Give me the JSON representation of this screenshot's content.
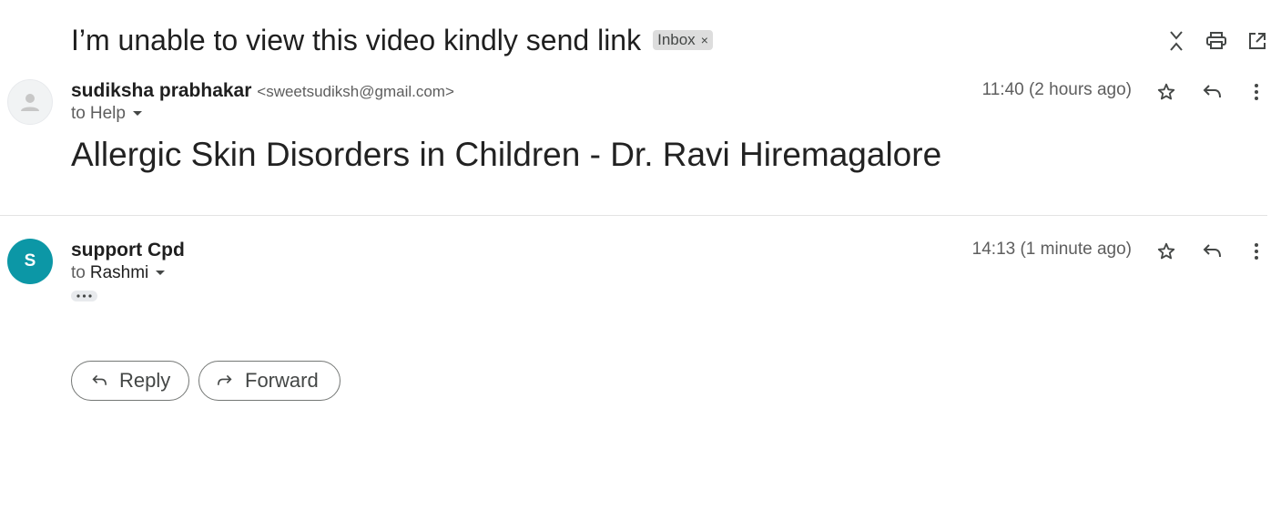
{
  "thread": {
    "subject": "I’m unable to view this video kindly send link",
    "label": "Inbox",
    "label_remove": "×"
  },
  "toolbar": {
    "icons": [
      "collapse-all-icon",
      "print-icon",
      "open-in-new-window-icon"
    ]
  },
  "messages": [
    {
      "sender_name": "sudiksha prabhakar",
      "sender_email": "<sweetsudiksh@gmail.com>",
      "to_prefix": "to",
      "to_recipient": "Help",
      "time": "11:40 (2 hours ago)",
      "body": "Allergic Skin Disorders in Children - Dr. Ravi Hiremagalore",
      "avatar": "default-person-icon"
    },
    {
      "sender_name": "support Cpd",
      "avatar_letter": "S",
      "to_prefix": "to",
      "to_recipient": "Rashmi",
      "time": "14:13 (1 minute ago)",
      "trimmed_content": "•••"
    }
  ],
  "actions": {
    "reply_label": "Reply",
    "forward_label": "Forward"
  },
  "colors": {
    "avatar_teal": "#0c97a6",
    "chip_bg": "#dddddd",
    "divider": "#e3e3e3"
  }
}
